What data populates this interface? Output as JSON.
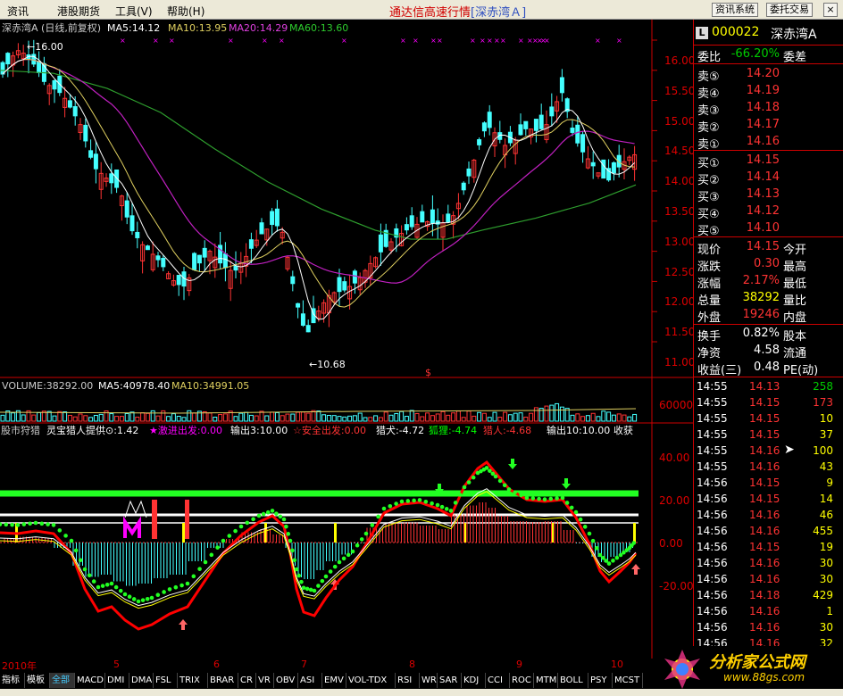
{
  "menu": {
    "items": [
      "资讯",
      "港股期货",
      "工具(V)",
      "帮助(H)"
    ],
    "title": "通达信高速行情",
    "title_tag": "[深赤湾Ａ]",
    "btn1": "资讯系统",
    "btn2": "委托交易",
    "close": "×"
  },
  "kline": {
    "caption": "深赤湾A (日线,前复权)",
    "ma5": "MA5:14.12",
    "ma10": "MA10:13.95",
    "ma20": "MA20:14.29",
    "ma60": "MA60:13.60",
    "high_label": "16.00",
    "low_label": "10.68",
    "yticks": [
      "16.00",
      "15.50",
      "15.00",
      "14.50",
      "14.00",
      "13.50",
      "13.00",
      "12.50",
      "12.00",
      "11.50",
      "11.00"
    ],
    "marker": "$"
  },
  "volume": {
    "caption": "VOLUME:38292.00",
    "ma5": "MA5:40978.40",
    "ma10": "MA10:34991.05",
    "ytick": "60000"
  },
  "indicator": {
    "caption": "股市狩猎",
    "c1": "灵宝猎人提供⊙:1.42",
    "c2": "★激进出发:0.00",
    "c3": "输出3:10.00",
    "c4": "☆安全出发:0.00",
    "c5": "猎犬:-4.72",
    "c6": "狐狸:-4.74",
    "c7": "猎人:-4.68",
    "c8": "输出10:10.00",
    "c9": "收获",
    "yticks": [
      "40.00",
      "20.00",
      "0.00",
      "-20.00"
    ]
  },
  "dates": [
    "2010年",
    "5",
    "6",
    "7",
    "8",
    "9",
    "10"
  ],
  "tabs": [
    "指标",
    "模板",
    "全部",
    "MACD",
    "DMI",
    "DMA",
    "FSL",
    "TRIX",
    "BRAR",
    "CR",
    "VR",
    "OBV",
    "ASI",
    "EMV",
    "VOL-TDX",
    "RSI",
    "WR",
    "SAR",
    "KDJ",
    "CCI",
    "ROC",
    "MTM",
    "BOLL",
    "PSY",
    "MCST"
  ],
  "quote": {
    "code": "000022",
    "name": "深赤湾A",
    "badge": "L",
    "weibi_label": "委比",
    "weibi": "-66.20%",
    "weicha_label": "委差",
    "asks": [
      {
        "l": "卖⑤",
        "p": "14.20"
      },
      {
        "l": "卖④",
        "p": "14.19"
      },
      {
        "l": "卖③",
        "p": "14.18"
      },
      {
        "l": "卖②",
        "p": "14.17"
      },
      {
        "l": "卖①",
        "p": "14.16"
      }
    ],
    "bids": [
      {
        "l": "买①",
        "p": "14.15"
      },
      {
        "l": "买②",
        "p": "14.14"
      },
      {
        "l": "买③",
        "p": "14.13"
      },
      {
        "l": "买④",
        "p": "14.12"
      },
      {
        "l": "买⑤",
        "p": "14.10"
      }
    ],
    "stats": [
      {
        "l": "现价",
        "v": "14.15",
        "k": "今开",
        "c": "#f33"
      },
      {
        "l": "涨跌",
        "v": "0.30",
        "k": "最高",
        "c": "#f33"
      },
      {
        "l": "涨幅",
        "v": "2.17%",
        "k": "最低",
        "c": "#f33"
      },
      {
        "l": "总量",
        "v": "38292",
        "k": "量比",
        "c": "#ff0"
      },
      {
        "l": "外盘",
        "v": "19246",
        "k": "内盘",
        "c": "#f33"
      }
    ],
    "stats2": [
      {
        "l": "换手",
        "v": "0.82%",
        "k": "股本"
      },
      {
        "l": "净资",
        "v": "4.58",
        "k": "流通"
      },
      {
        "l": "收益(三)",
        "v": "0.48",
        "k": "PE(动)"
      }
    ],
    "ticks": [
      {
        "t": "14:55",
        "p": "14.13",
        "v": "258",
        "c": "#0c0"
      },
      {
        "t": "14:55",
        "p": "14.15",
        "v": "173",
        "c": "#f33"
      },
      {
        "t": "14:55",
        "p": "14.15",
        "v": "10",
        "c": "#ff0"
      },
      {
        "t": "14:55",
        "p": "14.15",
        "v": "37",
        "c": "#ff0"
      },
      {
        "t": "14:55",
        "p": "14.16",
        "v": "100",
        "c": "#ff0"
      },
      {
        "t": "14:55",
        "p": "14.16",
        "v": "43",
        "c": "#ff0"
      },
      {
        "t": "14:56",
        "p": "14.15",
        "v": "9",
        "c": "#ff0"
      },
      {
        "t": "14:56",
        "p": "14.15",
        "v": "14",
        "c": "#ff0"
      },
      {
        "t": "14:56",
        "p": "14.16",
        "v": "46",
        "c": "#ff0"
      },
      {
        "t": "14:56",
        "p": "14.16",
        "v": "455",
        "c": "#ff0"
      },
      {
        "t": "14:56",
        "p": "14.15",
        "v": "19",
        "c": "#ff0"
      },
      {
        "t": "14:56",
        "p": "14.16",
        "v": "30",
        "c": "#ff0"
      },
      {
        "t": "14:56",
        "p": "14.16",
        "v": "30",
        "c": "#ff0"
      },
      {
        "t": "14:56",
        "p": "14.18",
        "v": "429",
        "c": "#ff0"
      },
      {
        "t": "14:56",
        "p": "14.16",
        "v": "1",
        "c": "#ff0"
      },
      {
        "t": "14:56",
        "p": "14.16",
        "v": "30",
        "c": "#ff0"
      },
      {
        "t": "14:56",
        "p": "14.16",
        "v": "32",
        "c": "#ff0"
      }
    ]
  },
  "logo": {
    "text": "分析家公式网",
    "url": "www.88gs.com"
  }
}
